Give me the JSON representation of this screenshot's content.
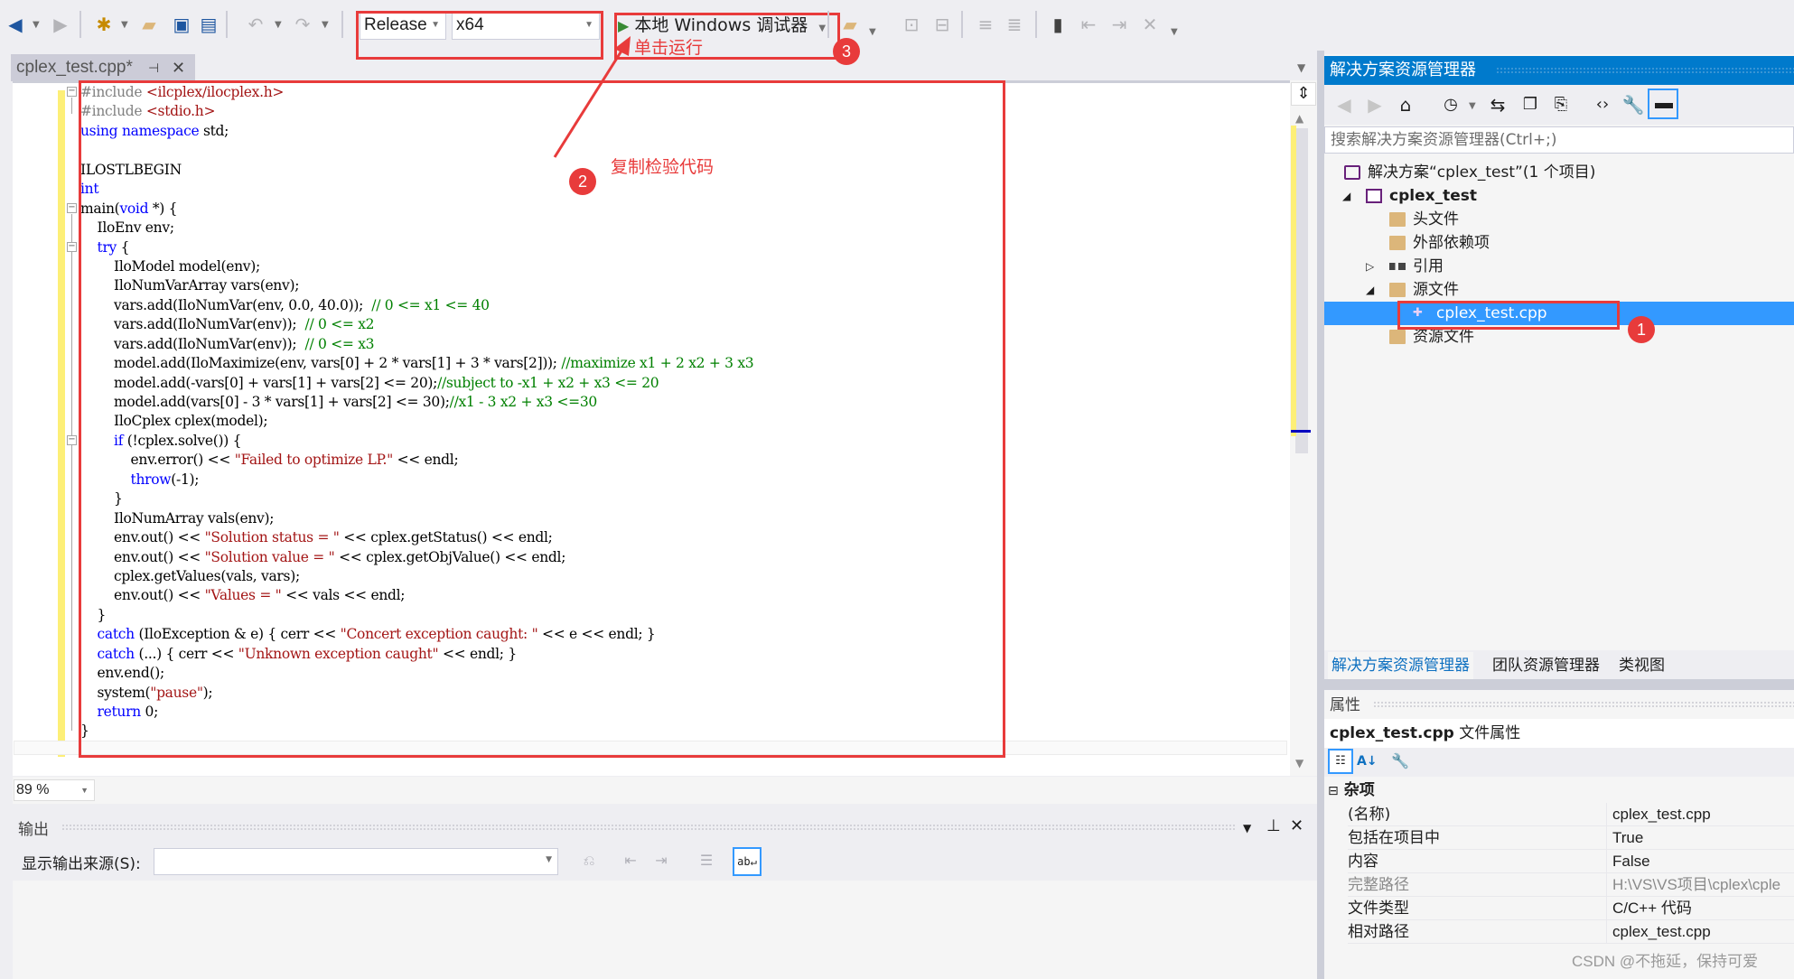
{
  "toolbar": {
    "configuration": "Release",
    "platform": "x64",
    "run_button_label": "本地 Windows 调试器",
    "icons": [
      "back-icon",
      "forward-icon",
      "new-project-icon",
      "open-file-icon",
      "save-icon",
      "save-all-icon",
      "undo-icon",
      "redo-icon",
      "find-in-files-icon",
      "comment-icon",
      "uncomment-icon",
      "outdent-icon",
      "indent-icon",
      "bookmark-icon",
      "prev-bookmark-icon",
      "next-bookmark-icon",
      "clear-bookmarks-icon"
    ]
  },
  "annotations": {
    "run_hint": "单击运行",
    "copy_hint": "复制检验代码",
    "badge_1": "1",
    "badge_2": "2",
    "badge_3": "3",
    "accent": "#e83b3b"
  },
  "document_tab": {
    "title": "cplex_test.cpp*",
    "pin": "⊣",
    "close": "✕"
  },
  "editor": {
    "zoom_level": "89 %",
    "lines": [
      [
        {
          "t": "#include ",
          "c": "pp"
        },
        {
          "t": "<ilcplex/ilocplex.h>",
          "c": "str"
        }
      ],
      [
        {
          "t": "#include ",
          "c": "pp"
        },
        {
          "t": "<stdio.h>",
          "c": "str"
        }
      ],
      [
        {
          "t": "using",
          "c": "kw"
        },
        {
          "t": " "
        },
        {
          "t": "namespace",
          "c": "kw"
        },
        {
          "t": " std;"
        }
      ],
      [
        {
          "t": ""
        }
      ],
      [
        {
          "t": "ILOSTLBEGIN"
        }
      ],
      [
        {
          "t": "int",
          "c": "kw"
        }
      ],
      [
        {
          "t": "main("
        },
        {
          "t": "void",
          "c": "kw"
        },
        {
          "t": " *) {"
        }
      ],
      [
        {
          "t": "    IloEnv env;"
        }
      ],
      [
        {
          "t": "    "
        },
        {
          "t": "try",
          "c": "kw"
        },
        {
          "t": " {"
        }
      ],
      [
        {
          "t": "        IloModel model(env);"
        }
      ],
      [
        {
          "t": "        IloNumVarArray vars(env);"
        }
      ],
      [
        {
          "t": "        vars.add(IloNumVar(env, 0.0, 40.0));  "
        },
        {
          "t": "// 0 <= x1 <= 40",
          "c": "cm"
        }
      ],
      [
        {
          "t": "        vars.add(IloNumVar(env));  "
        },
        {
          "t": "// 0 <= x2",
          "c": "cm"
        }
      ],
      [
        {
          "t": "        vars.add(IloNumVar(env));  "
        },
        {
          "t": "// 0 <= x3",
          "c": "cm"
        }
      ],
      [
        {
          "t": "        model.add(IloMaximize(env, vars[0] + 2 * vars[1] + 3 * vars[2])); "
        },
        {
          "t": "//maximize x1 + 2 x2 + 3 x3",
          "c": "cm"
        }
      ],
      [
        {
          "t": "        model.add(-vars[0] + vars[1] + vars[2] <= 20);"
        },
        {
          "t": "//subject to -x1 + x2 + x3 <= 20",
          "c": "cm"
        }
      ],
      [
        {
          "t": "        model.add(vars[0] - 3 * vars[1] + vars[2] <= 30);"
        },
        {
          "t": "//x1 - 3 x2 + x3 <=30",
          "c": "cm"
        }
      ],
      [
        {
          "t": "        IloCplex cplex(model);"
        }
      ],
      [
        {
          "t": "        "
        },
        {
          "t": "if",
          "c": "kw"
        },
        {
          "t": " (!cplex.solve()) {"
        }
      ],
      [
        {
          "t": "            env.error() << "
        },
        {
          "t": "\"Failed to optimize LP.\"",
          "c": "str"
        },
        {
          "t": " << endl;"
        }
      ],
      [
        {
          "t": "            "
        },
        {
          "t": "throw",
          "c": "kw"
        },
        {
          "t": "(-1);"
        }
      ],
      [
        {
          "t": "        }"
        }
      ],
      [
        {
          "t": "        IloNumArray vals(env);"
        }
      ],
      [
        {
          "t": "        env.out() << "
        },
        {
          "t": "\"Solution status = \"",
          "c": "str"
        },
        {
          "t": " << cplex.getStatus() << endl;"
        }
      ],
      [
        {
          "t": "        env.out() << "
        },
        {
          "t": "\"Solution value = \"",
          "c": "str"
        },
        {
          "t": " << cplex.getObjValue() << endl;"
        }
      ],
      [
        {
          "t": "        cplex.getValues(vals, vars);"
        }
      ],
      [
        {
          "t": "        env.out() << "
        },
        {
          "t": "\"Values = \"",
          "c": "str"
        },
        {
          "t": " << vals << endl;"
        }
      ],
      [
        {
          "t": "    }"
        }
      ],
      [
        {
          "t": "    "
        },
        {
          "t": "catch",
          "c": "kw"
        },
        {
          "t": " (IloException & e) { cerr << "
        },
        {
          "t": "\"Concert exception caught: \"",
          "c": "str"
        },
        {
          "t": " << e << endl; }"
        }
      ],
      [
        {
          "t": "    "
        },
        {
          "t": "catch",
          "c": "kw"
        },
        {
          "t": " (...) { cerr << "
        },
        {
          "t": "\"Unknown exception caught\"",
          "c": "str"
        },
        {
          "t": " << endl; }"
        }
      ],
      [
        {
          "t": "    env.end();"
        }
      ],
      [
        {
          "t": "    system("
        },
        {
          "t": "\"pause\"",
          "c": "str"
        },
        {
          "t": ");"
        }
      ],
      [
        {
          "t": "    "
        },
        {
          "t": "return",
          "c": "kw"
        },
        {
          "t": " 0;"
        }
      ],
      [
        {
          "t": "}"
        }
      ]
    ]
  },
  "output_pane": {
    "title": "输出",
    "source_label": "显示输出来源(S):",
    "source_value": "",
    "word_wrap_label": "ab↵"
  },
  "solution_explorer": {
    "title": "解决方案资源管理器",
    "search_placeholder": "搜索解决方案资源管理器(Ctrl+;)",
    "tree": [
      {
        "label": "解决方案“cplex_test”(1 个项目)",
        "icon": "solution-icon",
        "level": 0,
        "toggle": ""
      },
      {
        "label": "cplex_test",
        "icon": "cpp-project-icon",
        "level": 0,
        "toggle": "◢",
        "bold": true
      },
      {
        "label": "头文件",
        "icon": "folder-icon",
        "level": 1,
        "toggle": ""
      },
      {
        "label": "外部依赖项",
        "icon": "external-deps-icon",
        "level": 1,
        "toggle": ""
      },
      {
        "label": "引用",
        "icon": "references-icon",
        "level": 1,
        "toggle": "▷"
      },
      {
        "label": "源文件",
        "icon": "folder-open-icon",
        "level": 1,
        "toggle": "◢"
      },
      {
        "label": "cplex_test.cpp",
        "icon": "cpp-file-icon",
        "level": 2,
        "toggle": "",
        "selected": true
      },
      {
        "label": "资源文件",
        "icon": "folder-icon",
        "level": 1,
        "toggle": ""
      }
    ],
    "selected_color": "#3399ff",
    "title_color": "#007acc"
  },
  "panel_tabs": [
    {
      "label": "解决方案资源管理器",
      "active": true
    },
    {
      "label": "团队资源管理器",
      "active": false
    },
    {
      "label": "类视图",
      "active": false
    }
  ],
  "properties": {
    "title": "属性",
    "object_name": "cplex_test.cpp",
    "object_type": "文件属性",
    "category": "杂项",
    "rows": [
      {
        "name": "(名称)",
        "value": "cplex_test.cpp",
        "muted": false
      },
      {
        "name": "包括在项目中",
        "value": "True",
        "muted": false
      },
      {
        "name": "内容",
        "value": "False",
        "muted": false
      },
      {
        "name": "完整路径",
        "value": "H:\\VS\\VS项目\\cplex\\cple",
        "muted": true
      },
      {
        "name": "文件类型",
        "value": "C/C++ 代码",
        "muted": false
      },
      {
        "name": "相对路径",
        "value": "cplex_test.cpp",
        "muted": false
      }
    ]
  },
  "watermark": "CSDN @不拖延，保持可爱"
}
